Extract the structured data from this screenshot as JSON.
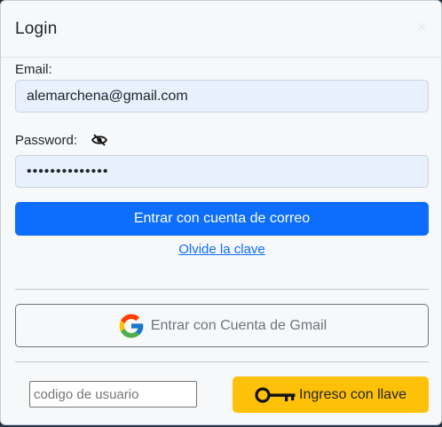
{
  "modal": {
    "title": "Login",
    "close_glyph": "×"
  },
  "email": {
    "label": "Email:",
    "value": "alemarchena@gmail.com"
  },
  "password": {
    "label": "Password:",
    "value": "••••••••••••••",
    "toggle_icon": "eye-slash-icon"
  },
  "buttons": {
    "login_email": "Entrar con cuenta de correo",
    "forgot_link": "Olvide la clave",
    "gmail": "Entrar con Cuenta de Gmail",
    "key_login": "Ingreso con llave"
  },
  "code_field": {
    "placeholder": "codigo de usuario"
  },
  "colors": {
    "primary": "#0d6efd",
    "warning": "#ffc107",
    "input_bg": "#e8effd"
  }
}
